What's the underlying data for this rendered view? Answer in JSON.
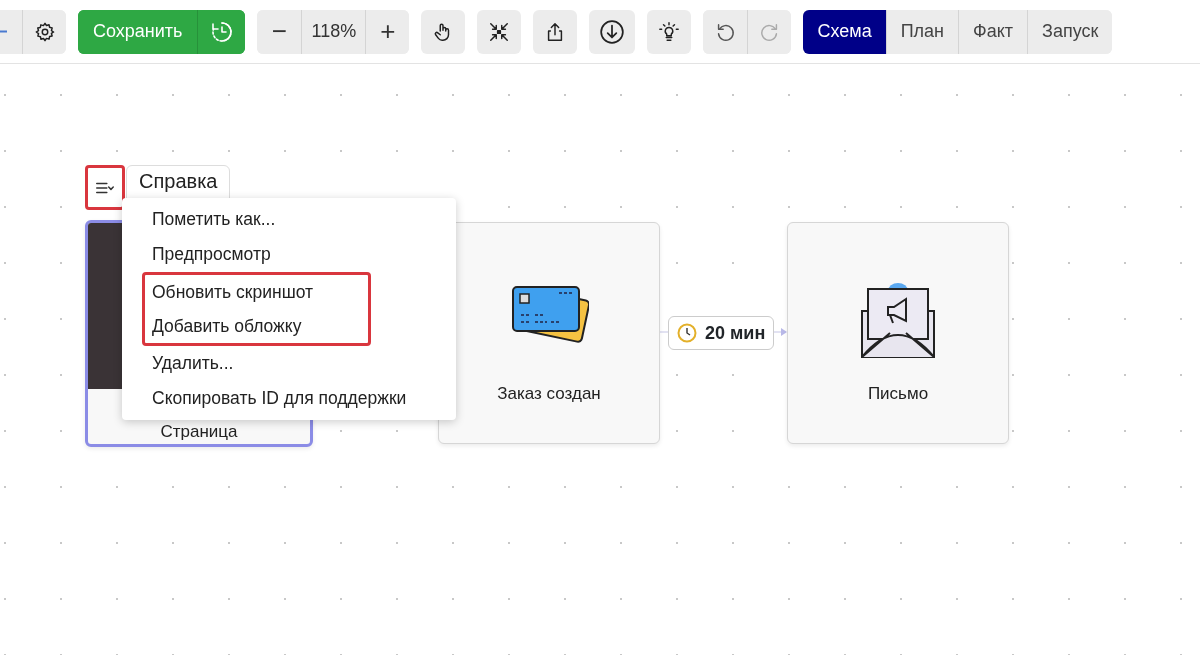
{
  "toolbar": {
    "save": {
      "label": "Сохранить"
    },
    "zoom": {
      "value": "118%",
      "minus": "−",
      "plus": "+"
    },
    "view_tabs": [
      {
        "label": "Схема",
        "selected": true
      },
      {
        "label": "План",
        "selected": false
      },
      {
        "label": "Факт",
        "selected": false
      },
      {
        "label": "Запуск",
        "selected": false
      }
    ],
    "redo_disabled": true
  },
  "canvas": {
    "nodes": [
      {
        "kind": "page",
        "label": "Страница",
        "tab": "Справка",
        "selected": true,
        "menu_button_highlighted": true
      },
      {
        "kind": "card",
        "label": "Заказ создан",
        "selected": false
      },
      {
        "kind": "mail",
        "label": "Письмо",
        "selected": false
      }
    ],
    "delay": {
      "label": "20 мин"
    },
    "context_menu": {
      "items": [
        {
          "label": "Пометить как...",
          "highlighted": false
        },
        {
          "label": "Предпросмотр",
          "highlighted": false
        },
        {
          "label": "Обновить скриншот",
          "highlighted": true
        },
        {
          "label": "Добавить обложку",
          "highlighted": true
        },
        {
          "label": "Удалить...",
          "highlighted": false
        },
        {
          "label": "Скопировать ID для поддержки",
          "highlighted": false
        }
      ]
    }
  }
}
